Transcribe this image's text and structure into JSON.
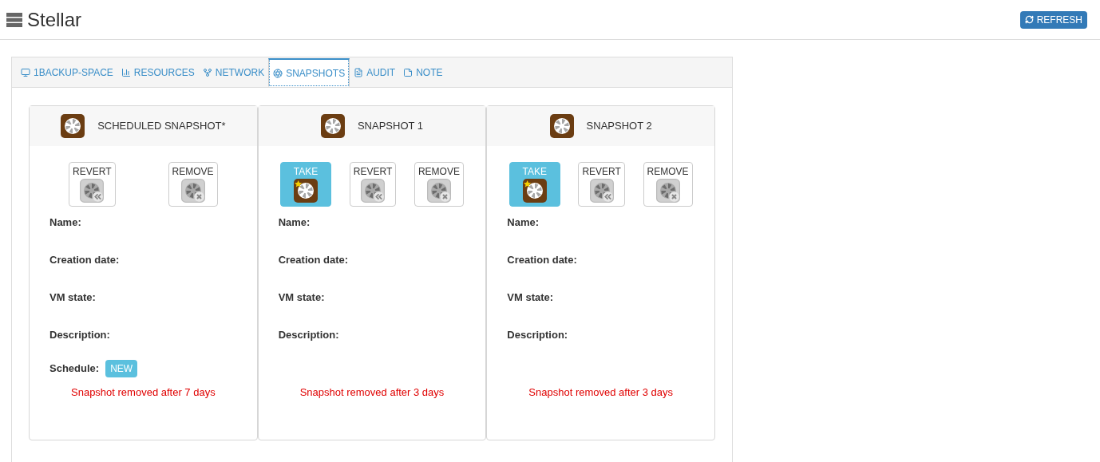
{
  "header": {
    "title": "Stellar",
    "refresh_button": "REFRESH"
  },
  "tabs": [
    {
      "label": "1BACKUP-SPACE",
      "selected": false
    },
    {
      "label": "RESOURCES",
      "selected": false
    },
    {
      "label": "NETWORK",
      "selected": false
    },
    {
      "label": "SNAPSHOTS",
      "selected": true
    },
    {
      "label": "AUDIT",
      "selected": false
    },
    {
      "label": "NOTE",
      "selected": false
    }
  ],
  "cards": [
    {
      "title": "SCHEDULED SNAPSHOT*",
      "buttons": [
        {
          "kind": "revert",
          "label": "REVERT",
          "disabled": true
        },
        {
          "kind": "remove",
          "label": "REMOVE",
          "disabled": true
        }
      ],
      "fields": [
        "Name:",
        "Creation date:",
        "VM state:",
        "Description:"
      ],
      "schedule": {
        "label": "Schedule:",
        "badge": "NEW"
      },
      "note": "Snapshot removed after 7 days"
    },
    {
      "title": "SNAPSHOT 1",
      "buttons": [
        {
          "kind": "take",
          "label": "TAKE",
          "disabled": false
        },
        {
          "kind": "revert",
          "label": "REVERT",
          "disabled": true
        },
        {
          "kind": "remove",
          "label": "REMOVE",
          "disabled": true
        }
      ],
      "fields": [
        "Name:",
        "Creation date:",
        "VM state:",
        "Description:"
      ],
      "note": "Snapshot removed after 3 days"
    },
    {
      "title": "SNAPSHOT 2",
      "buttons": [
        {
          "kind": "take",
          "label": "TAKE",
          "disabled": false
        },
        {
          "kind": "revert",
          "label": "REVERT",
          "disabled": true
        },
        {
          "kind": "remove",
          "label": "REMOVE",
          "disabled": true
        }
      ],
      "fields": [
        "Name:",
        "Creation date:",
        "VM state:",
        "Description:"
      ],
      "note": "Snapshot removed after 3 days"
    }
  ]
}
